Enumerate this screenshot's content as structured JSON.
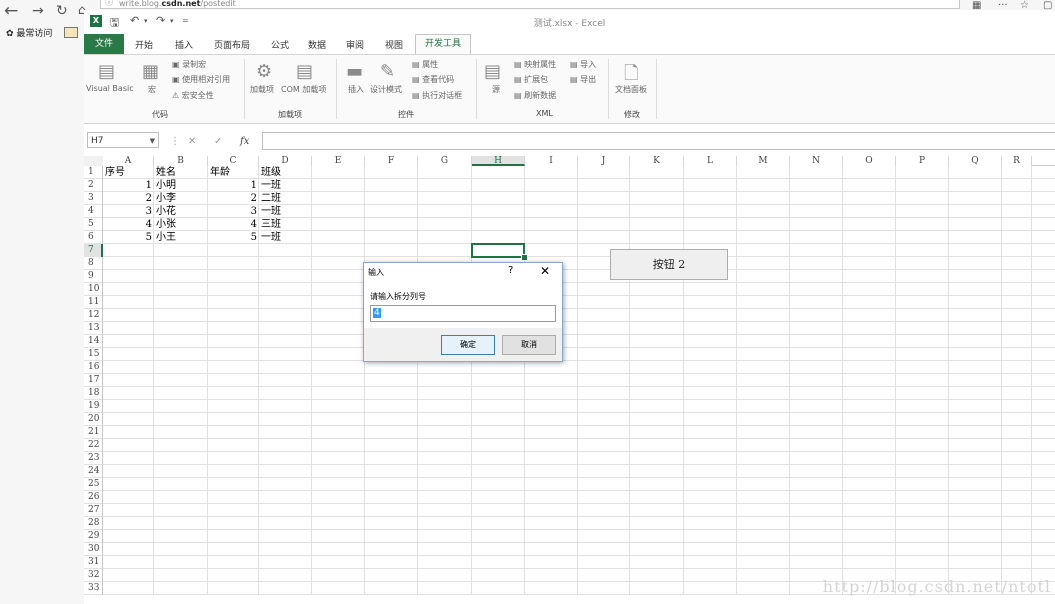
{
  "browser": {
    "url_prefix": "write.blog.",
    "url_domain": "csdn.net",
    "url_path": "/postedit",
    "bookmark_label": "最常访问"
  },
  "window_title": "测试.xlsx - Excel",
  "tabs": [
    "文件",
    "开始",
    "插入",
    "页面布局",
    "公式",
    "数据",
    "审阅",
    "视图",
    "开发工具"
  ],
  "ribbon": {
    "visual_basic": "Visual Basic",
    "macro": "宏",
    "record_macro": "录制宏",
    "relative_ref": "使用相对引用",
    "macro_security": "宏安全性",
    "group_code": "代码",
    "addins": "加载项",
    "com_addins": "COM 加载项",
    "group_addins": "加载项",
    "insert": "插入",
    "design_mode": "设计模式",
    "properties": "属性",
    "view_code": "查看代码",
    "run_dialog": "执行对话框",
    "group_controls": "控件",
    "source": "源",
    "map_properties": "映射属性",
    "expansion_packs": "扩展包",
    "refresh_data": "刷新数据",
    "import": "导入",
    "export": "导出",
    "group_xml": "XML",
    "document_panel": "文档面板",
    "group_modify": "修改"
  },
  "name_box": "H7",
  "fx_label": "fx",
  "columns": [
    "A",
    "B",
    "C",
    "D",
    "E",
    "F",
    "G",
    "H",
    "I",
    "J",
    "K",
    "L",
    "M",
    "N",
    "O",
    "P",
    "Q",
    "R"
  ],
  "selected_column": "H",
  "selected_row": 7,
  "row_count": 33,
  "cells": {
    "A1": "序号",
    "B1": "姓名",
    "C1": "年龄",
    "D1": "班级",
    "A2": "1",
    "B2": "小明",
    "C2": "1",
    "D2": "一班",
    "A3": "2",
    "B3": "小李",
    "C3": "2",
    "D3": "二班",
    "A4": "3",
    "B4": "小花",
    "C4": "3",
    "D4": "一班",
    "A5": "4",
    "B5": "小张",
    "C5": "4",
    "D5": "三班",
    "A6": "5",
    "B6": "小王",
    "C6": "5",
    "D6": "一班"
  },
  "form_button_label": "按钮 2",
  "dialog": {
    "title": "输入",
    "help": "?",
    "close": "✕",
    "prompt": "请输入拆分列号",
    "value": "4",
    "ok": "确定",
    "cancel": "取消"
  },
  "watermark": "http://blog.csdn.net/ntotl"
}
